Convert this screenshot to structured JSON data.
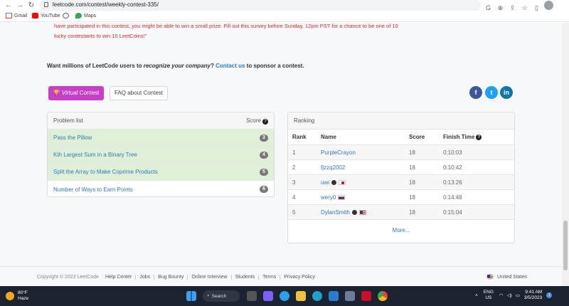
{
  "browser": {
    "url": "leetcode.com/contest/weekly-contest-335/",
    "bookmarks": [
      "Gmail",
      "YouTube",
      "Maps"
    ]
  },
  "notice": {
    "survey_text": "have participated in this contest, you might be able to win a small prize. Fill out this survey before Sunday, 12pm PST for a chance to be one of 10 lucky contestants to win 10 LeetCoins!\""
  },
  "sponsor": {
    "prefix": "Want millions of LeetCode users to",
    "emphasis": "recognize your company",
    "link": "Contact us",
    "suffix": "to sponsor a contest."
  },
  "actions": {
    "virtual_label": "Virtual",
    "virtual_suffix": "Contest",
    "faq_label": "FAQ about Contest"
  },
  "problems": {
    "header": "Problem list",
    "score_header": "Score",
    "items": [
      {
        "title": "Pass the Pillow",
        "score": "3",
        "solved": true
      },
      {
        "title": "Kth Largest Sum in a Binary Tree",
        "score": "4",
        "solved": true
      },
      {
        "title": "Split the Array to Make Coprime Products",
        "score": "5",
        "solved": true
      },
      {
        "title": "Number of Ways to Earn Points",
        "score": "6",
        "solved": false
      }
    ]
  },
  "ranking": {
    "header": "Ranking",
    "columns": {
      "rank": "Rank",
      "name": "Name",
      "score": "Score",
      "time": "Finish Time"
    },
    "rows": [
      {
        "rank": "1",
        "name": "PurpleCrayon",
        "score": "18",
        "time": "0:10:03"
      },
      {
        "rank": "2",
        "name": "fjzzq2002",
        "score": "18",
        "time": "0:10:42"
      },
      {
        "rank": "3",
        "name": "uwi",
        "score": "18",
        "time": "0:13:26"
      },
      {
        "rank": "4",
        "name": "wery0",
        "score": "18",
        "time": "0:14:48"
      },
      {
        "rank": "5",
        "name": "DylanSmith",
        "score": "18",
        "time": "0:15:04"
      }
    ],
    "more": "More..."
  },
  "footer": {
    "copyright": "Copyright © 2023 LeetCode",
    "links": [
      "Help Center",
      "Jobs",
      "Bug Bounty",
      "Online Interview",
      "Students",
      "Terms",
      "Privacy Policy"
    ],
    "region": "United States"
  },
  "taskbar": {
    "temp": "80°F",
    "weather": "Haze",
    "search": "Search",
    "lang_top": "ENG",
    "lang_bottom": "US",
    "time": "9:41 AM",
    "date": "3/5/2023",
    "notifications": "1"
  },
  "colors": {
    "accent": "#c73ec8",
    "link": "#337ab7",
    "solved_bg": "#dff0d8",
    "notice_red": "#e02b2b"
  }
}
